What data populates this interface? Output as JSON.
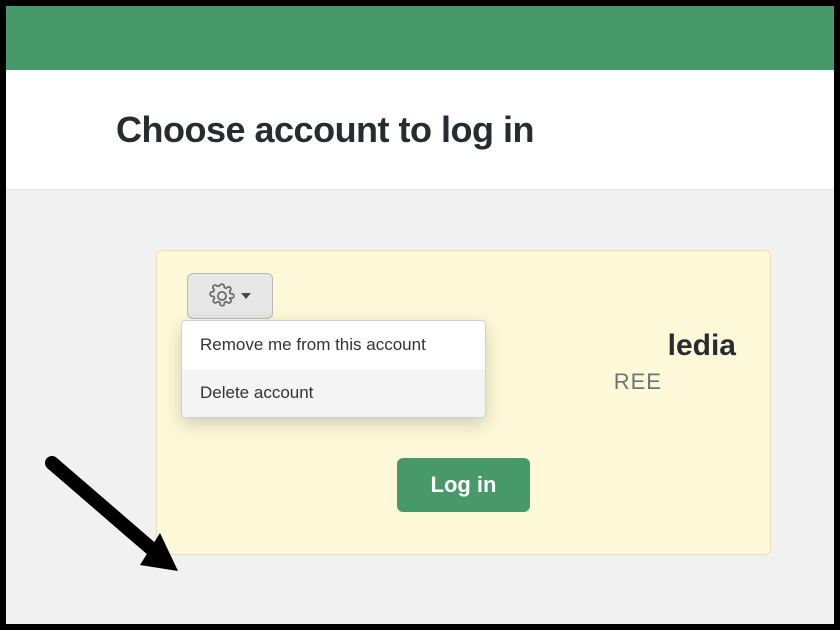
{
  "colors": {
    "brand_green": "#48996a",
    "card_bg": "#fdf9d8"
  },
  "header": {
    "title": "Choose account to log in"
  },
  "card": {
    "account_name_visible_fragment": "ledia",
    "plan_visible_fragment": "REE",
    "login_label": "Log in",
    "gear_icon": "gear-icon",
    "dropdown": {
      "items": [
        {
          "label": "Remove me from this account"
        },
        {
          "label": "Delete account"
        }
      ]
    }
  }
}
